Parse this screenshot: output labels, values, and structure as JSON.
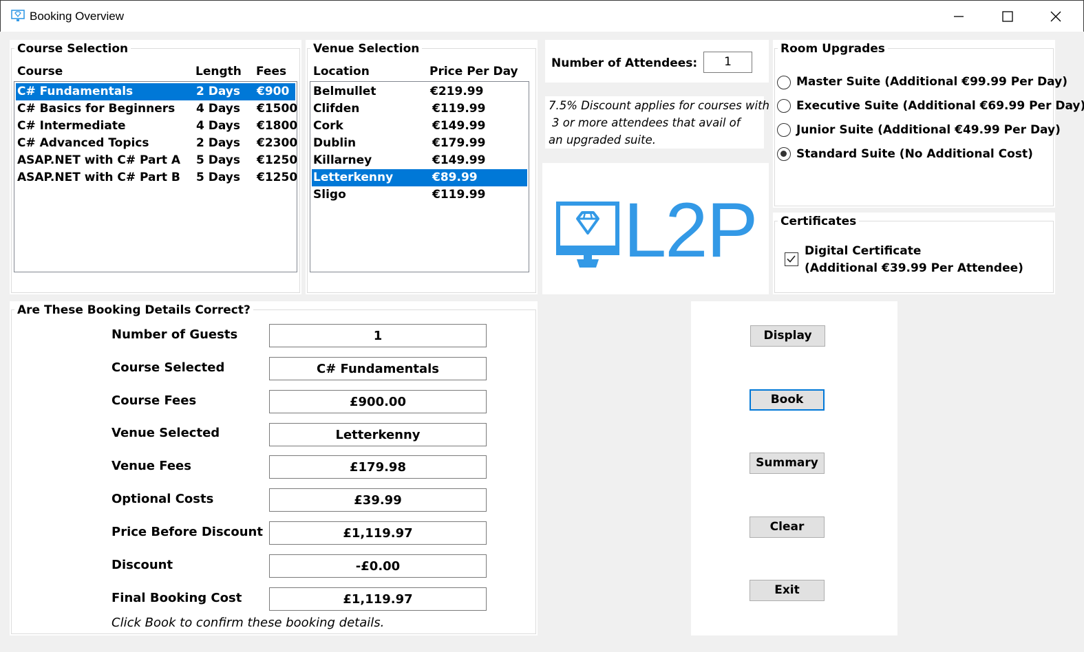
{
  "window": {
    "title": "Booking Overview",
    "controls": {
      "minimize": "minimize-icon",
      "maximize": "maximize-icon",
      "close": "close-icon"
    }
  },
  "course_selection": {
    "title": "Course Selection",
    "headers": {
      "course": "Course",
      "length": "Length",
      "fees": "Fees"
    },
    "rows": [
      {
        "course": "C# Fundamentals",
        "length": "2 Days",
        "fees": "€900"
      },
      {
        "course": "C# Basics for Beginners",
        "length": "4 Days",
        "fees": "€1500"
      },
      {
        "course": "C# Intermediate",
        "length": "4 Days",
        "fees": "€1800"
      },
      {
        "course": "C# Advanced Topics",
        "length": "2 Days",
        "fees": "€2300"
      },
      {
        "course": "ASAP.NET with C# Part A",
        "length": "5 Days",
        "fees": "€1250"
      },
      {
        "course": "ASAP.NET with C# Part B",
        "length": "5 Days",
        "fees": "€1250"
      }
    ],
    "selected": "C# Fundamentals"
  },
  "venue_selection": {
    "title": "Venue Selection",
    "headers": {
      "location": "Location",
      "price": "Price Per Day"
    },
    "rows": [
      {
        "location": "Belmullet",
        "price": "€219.99"
      },
      {
        "location": "Clifden",
        "price": "€119.99"
      },
      {
        "location": "Cork",
        "price": "€149.99"
      },
      {
        "location": "Dublin",
        "price": "€179.99"
      },
      {
        "location": "Killarney",
        "price": "€149.99"
      },
      {
        "location": "Letterkenny",
        "price": "€89.99"
      },
      {
        "location": "Sligo",
        "price": "€119.99"
      }
    ],
    "selected": "Letterkenny"
  },
  "attendees": {
    "label": "Number of Attendees:",
    "value": "1"
  },
  "discount_note": {
    "line1": "7.5% Discount applies for courses with",
    "line2": "3 or more attendees that avail of",
    "line3": "an upgraded suite."
  },
  "logo": {
    "text": "L2P",
    "color": "#3399e6"
  },
  "room_upgrades": {
    "title": "Room Upgrades",
    "options": [
      {
        "label": "Master Suite (Additional €99.99 Per Day)",
        "selected": false
      },
      {
        "label": "Executive Suite (Additional €69.99 Per Day)",
        "selected": false
      },
      {
        "label": "Junior Suite (Additional €49.99 Per Day)",
        "selected": false
      },
      {
        "label": "Standard Suite (No Additional Cost)",
        "selected": true
      }
    ]
  },
  "certificates": {
    "title": "Certificates",
    "label_line1": "Digital Certificate",
    "label_line2": "(Additional €39.99 Per Attendee)",
    "checked": true
  },
  "details": {
    "title": "Are These Booking Details Correct?",
    "fields": [
      {
        "label": "Number of Guests",
        "value": "1"
      },
      {
        "label": "Course Selected",
        "value": "C# Fundamentals"
      },
      {
        "label": "Course Fees",
        "value": "£900.00"
      },
      {
        "label": "Venue Selected",
        "value": "Letterkenny"
      },
      {
        "label": "Venue Fees",
        "value": "£179.98"
      },
      {
        "label": "Optional Costs",
        "value": "£39.99"
      },
      {
        "label": "Price Before Discount",
        "value": "£1,119.97"
      },
      {
        "label": "Discount",
        "value": "-£0.00"
      },
      {
        "label": "Final Booking Cost",
        "value": "£1,119.97"
      }
    ],
    "footer": "Click Book to confirm these booking details."
  },
  "actions": {
    "display": "Display",
    "book": "Book",
    "summary": "Summary",
    "clear": "Clear",
    "exit": "Exit"
  },
  "colors": {
    "selection": "#0078d7",
    "accent": "#0078d7",
    "window_bg": "#f0f0f0"
  }
}
